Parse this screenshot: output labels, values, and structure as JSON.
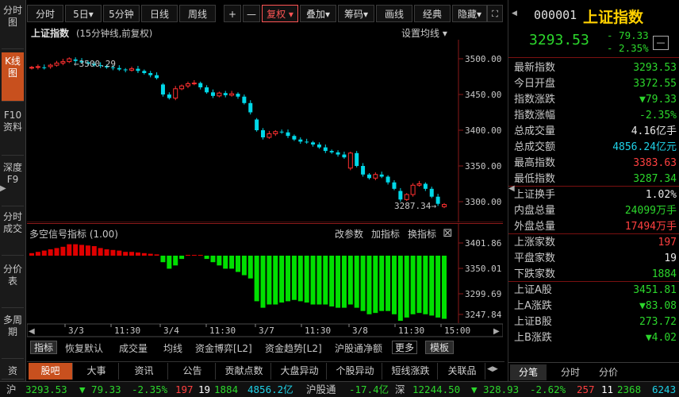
{
  "left_tabs": [
    "分时图",
    "K线图",
    "F10资料",
    "深度F9",
    "分时成交",
    "分价表",
    "多周期",
    "资"
  ],
  "toolbar": {
    "items": [
      "分时",
      "5日▾",
      "5分钟",
      "日线",
      "周线",
      "+",
      "—",
      "复权 ▾",
      "叠加▾",
      "筹码▾",
      "画线",
      "经典",
      "隐藏▾"
    ],
    "active": "复权 ▾"
  },
  "chart": {
    "title": "上证指数",
    "subtitle": "(15分钟线,前复权)",
    "settings_label": "设置均线 ▾",
    "high_label": "←3500.29",
    "low_label": "3287.34→",
    "y_ticks": [
      "3500.00",
      "3450.00",
      "3400.00",
      "3350.00",
      "3300.00"
    ],
    "x_labels": [
      "3/3",
      "11:30",
      "3/4",
      "11:30",
      "3/7",
      "11:30",
      "3/8",
      "11:30",
      "15:00"
    ]
  },
  "indicator": {
    "title": "多空信号指标 (1.00)",
    "actions": [
      "改参数",
      "加指标",
      "换指标"
    ],
    "close_icon": "⊠",
    "y_ticks": [
      "3401.86",
      "3350.01",
      "3299.69",
      "3247.84"
    ]
  },
  "chart_data": {
    "type": "candlestick",
    "title": "上证指数",
    "ylim": [
      3270,
      3530
    ],
    "closes": [
      3488,
      3489,
      3487,
      3491,
      3494,
      3496,
      3500,
      3497,
      3495,
      3493,
      3491,
      3490,
      3488,
      3487,
      3485,
      3484,
      3486,
      3483,
      3480,
      3477,
      3473,
      3450,
      3445,
      3458,
      3462,
      3465,
      3466,
      3460,
      3453,
      3448,
      3452,
      3449,
      3451,
      3447,
      3438,
      3425,
      3400,
      3390,
      3395,
      3398,
      3397,
      3392,
      3387,
      3384,
      3383,
      3380,
      3376,
      3371,
      3369,
      3366,
      3362,
      3368,
      3350,
      3338,
      3333,
      3338,
      3335,
      3327,
      3318,
      3303,
      3310,
      3323,
      3325,
      3318,
      3307,
      3297,
      3296
    ],
    "opens": [
      3487,
      3488,
      3488,
      3489,
      3491,
      3494,
      3496,
      3499,
      3497,
      3495,
      3493,
      3491,
      3490,
      3488,
      3487,
      3485,
      3484,
      3486,
      3483,
      3480,
      3477,
      3464,
      3450,
      3445,
      3458,
      3462,
      3465,
      3466,
      3460,
      3453,
      3448,
      3452,
      3449,
      3451,
      3447,
      3438,
      3415,
      3400,
      3390,
      3395,
      3398,
      3397,
      3392,
      3387,
      3384,
      3383,
      3380,
      3376,
      3371,
      3369,
      3366,
      3347,
      3368,
      3350,
      3338,
      3333,
      3338,
      3335,
      3327,
      3315,
      3303,
      3310,
      3323,
      3325,
      3318,
      3307,
      3293
    ],
    "signal": [
      0.2,
      0.3,
      0.4,
      0.5,
      0.6,
      0.7,
      0.9,
      0.9,
      0.85,
      0.8,
      0.75,
      0.6,
      0.5,
      0.45,
      0.4,
      0.3,
      0.3,
      0.25,
      0.2,
      0.15,
      0.1,
      -0.1,
      -0.2,
      -0.15,
      -0.05,
      0.05,
      0.05,
      0.03,
      -0.05,
      -0.1,
      -0.15,
      -0.2,
      -0.2,
      -0.25,
      -0.3,
      -0.35,
      -0.7,
      -0.8,
      -0.75,
      -0.75,
      -0.72,
      -0.7,
      -0.68,
      -0.7,
      -0.72,
      -0.75,
      -0.75,
      -0.75,
      -0.78,
      -0.8,
      -0.8,
      -0.75,
      -0.8,
      -0.85,
      -0.9,
      -0.88,
      -0.85,
      -0.85,
      -0.9,
      -1.0,
      -0.95,
      -0.9,
      -0.88,
      -0.9,
      -0.92,
      -0.95,
      -0.97
    ]
  },
  "stock": {
    "code": "000001",
    "name": "上证指数",
    "price": "3293.53",
    "change": "- 79.33",
    "change_pct": "- 2.35%",
    "minus_icon": "—"
  },
  "quote_rows": [
    {
      "k": "最新指数",
      "v": "3293.53",
      "c": "green"
    },
    {
      "k": "今日开盘",
      "v": "3372.55",
      "c": "green"
    },
    {
      "k": "指数涨跌",
      "v": "▼79.33",
      "c": "green"
    },
    {
      "k": "指数涨幅",
      "v": "-2.35%",
      "c": "green"
    },
    {
      "k": "总成交量",
      "v": "4.16亿手",
      "c": "white"
    },
    {
      "k": "总成交额",
      "v": "4856.24亿元",
      "c": "cyan"
    },
    {
      "k": "最高指数",
      "v": "3383.63",
      "c": "red"
    },
    {
      "k": "最低指数",
      "v": "3287.34",
      "c": "green"
    },
    {
      "k": "上证换手",
      "v": "1.02%",
      "c": "white"
    },
    {
      "k": "内盘总量",
      "v": "24099万手",
      "c": "green"
    },
    {
      "k": "外盘总量",
      "v": "17494万手",
      "c": "red"
    },
    {
      "k": "上涨家数",
      "v": "197",
      "c": "red"
    },
    {
      "k": "平盘家数",
      "v": "19",
      "c": "white"
    },
    {
      "k": "下跌家数",
      "v": "1884",
      "c": "green"
    },
    {
      "k": "上证A股",
      "v": "3451.81",
      "c": "green"
    },
    {
      "k": "上A涨跌",
      "v": "▼83.08",
      "c": "green"
    },
    {
      "k": "上证B股",
      "v": "273.72",
      "c": "green"
    },
    {
      "k": "上B涨跌",
      "v": "▼4.02",
      "c": "green"
    }
  ],
  "right_tabs": [
    "分笔",
    "分时",
    "分价"
  ],
  "indicator_tabs": [
    "指标",
    "恢复默认",
    "成交量",
    "均线",
    "资金博弈[L2]",
    "资金趋势[L2]",
    "沪股通净额",
    "更多",
    "模板"
  ],
  "news_tabs": [
    "股吧",
    "大事",
    "资讯",
    "公告",
    "贡献点数",
    "大盘异动",
    "个股异动",
    "短线涨跌",
    "关联品"
  ],
  "status_bar": {
    "sh_label": "沪",
    "sh_price": "3293.53",
    "sh_change": "▼ 79.33",
    "sh_pct": "-2.35%",
    "sh_up": "197",
    "sh_flat": "19",
    "sh_down": "1884",
    "sh_amount": "4856.2亿",
    "hgt_label": "沪股通",
    "hgt_value": "-17.4亿",
    "sz_label": "深",
    "sz_price": "12244.50",
    "sz_change": "▼ 328.93",
    "sz_pct": "-2.62%",
    "sz_up": "257",
    "sz_flat": "11",
    "sz_down": "2368",
    "sz_amount": "6243"
  },
  "colors": {
    "up": "#ff3030",
    "down": "#00d8e8",
    "accent": "#c8501e",
    "signal_up": "#e00000",
    "signal_down": "#00e000"
  }
}
